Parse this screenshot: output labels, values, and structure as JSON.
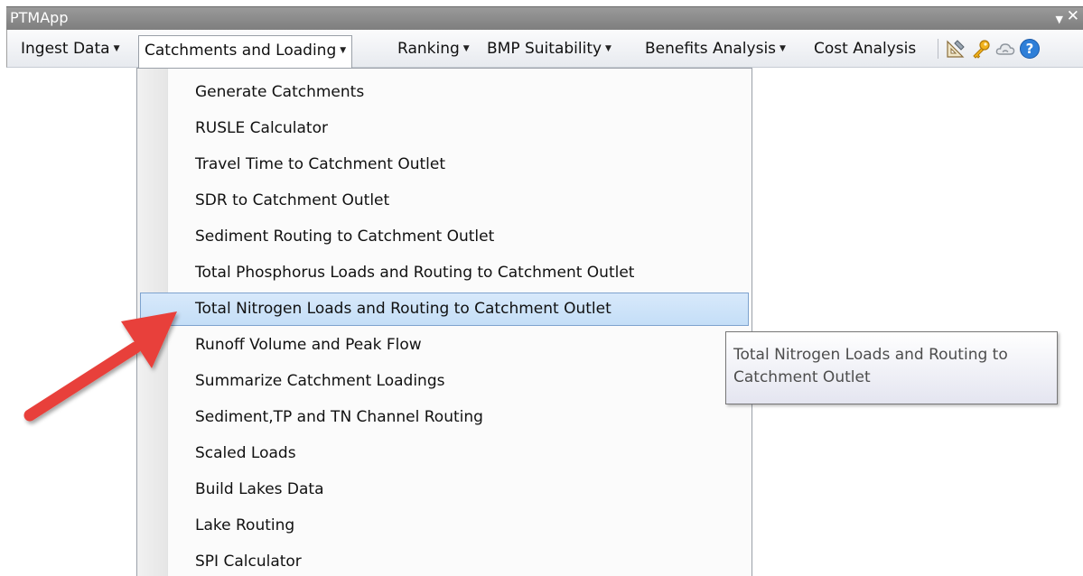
{
  "window": {
    "title": "PTMApp"
  },
  "toolbar": {
    "menus": [
      {
        "label": "Ingest Data"
      },
      {
        "label": "Catchments and Loading"
      },
      {
        "label": "Ranking"
      },
      {
        "label": "BMP Suitability"
      },
      {
        "label": "Benefits Analysis"
      },
      {
        "label": "Cost Analysis"
      }
    ],
    "icons": [
      "ruler-triangle-icon",
      "key-icon",
      "cloud-icon",
      "help-icon"
    ],
    "open_menu": "Catchments and Loading"
  },
  "menu": {
    "items": [
      {
        "label": "Generate Catchments"
      },
      {
        "label": "RUSLE Calculator"
      },
      {
        "label": "Travel Time to Catchment Outlet"
      },
      {
        "label": "SDR to Catchment Outlet"
      },
      {
        "label": "Sediment Routing to Catchment Outlet"
      },
      {
        "label": "Total Phosphorus Loads and Routing to Catchment Outlet"
      },
      {
        "label": "Total Nitrogen Loads and Routing to Catchment Outlet"
      },
      {
        "label": "Runoff Volume and Peak Flow"
      },
      {
        "label": "Summarize Catchment Loadings"
      },
      {
        "label": "Sediment,TP and TN Channel Routing"
      },
      {
        "label": "Scaled Loads"
      },
      {
        "label": "Build Lakes Data"
      },
      {
        "label": "Lake Routing"
      },
      {
        "label": "SPI Calculator"
      }
    ],
    "highlighted_item": "Total Nitrogen Loads and Routing to Catchment Outlet"
  },
  "tooltip": {
    "line1": "Total Nitrogen Loads and Routing to",
    "line2": "Catchment Outlet"
  },
  "colors": {
    "titlebar": "#8a8a8a",
    "highlight": "#cfe4fa",
    "arrow": "#e8403a"
  }
}
